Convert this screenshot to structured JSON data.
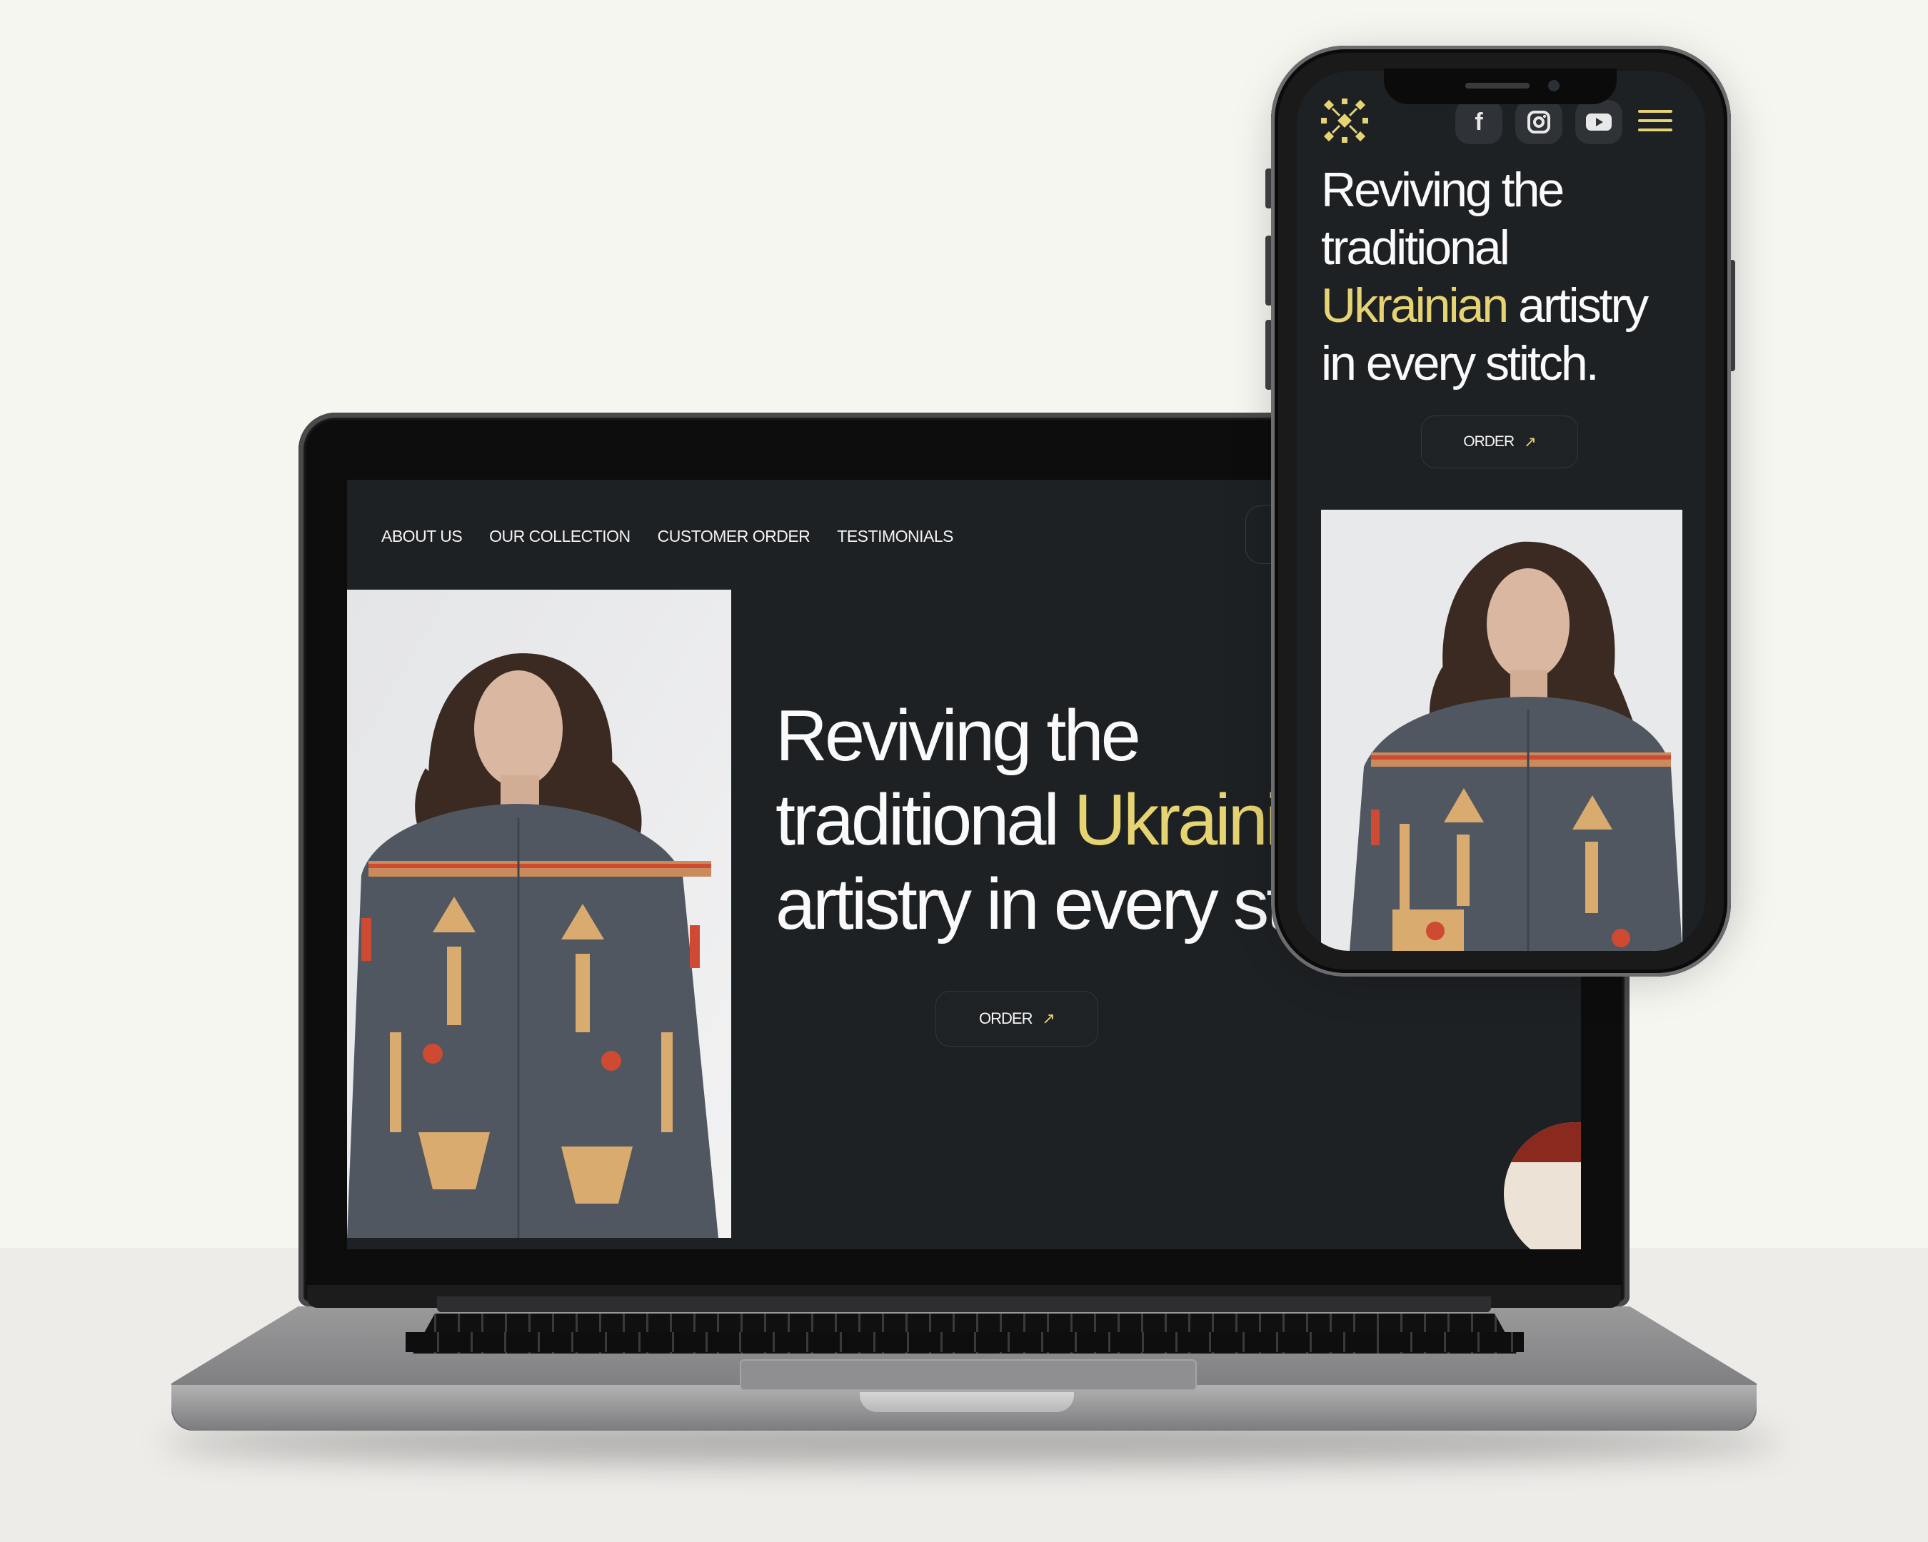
{
  "desktop": {
    "nav": [
      "ABOUT US",
      "OUR COLLECTION",
      "CUSTOMER ORDER",
      "TESTIMONIALS"
    ],
    "headline": {
      "line1": "Reviving the",
      "line2_prefix": "traditional ",
      "line2_accent": "Ukrainian",
      "line3": "artistry in every stitch."
    },
    "order_button": "ORDER",
    "arrow": "↗"
  },
  "mobile": {
    "headline": {
      "line1": "Reviving the",
      "line2": "traditional",
      "line3_accent": "Ukrainian",
      "line3_rest": " artistry",
      "line4": "in every stitch."
    },
    "order_button": "ORDER",
    "arrow": "↗",
    "social_icons": [
      "facebook-icon",
      "instagram-icon",
      "youtube-icon"
    ],
    "social_glyphs": [
      "f",
      "◎",
      "▶"
    ]
  },
  "colors": {
    "background": "#1e2124",
    "accent": "#e6d372",
    "text": "#fafafa"
  }
}
